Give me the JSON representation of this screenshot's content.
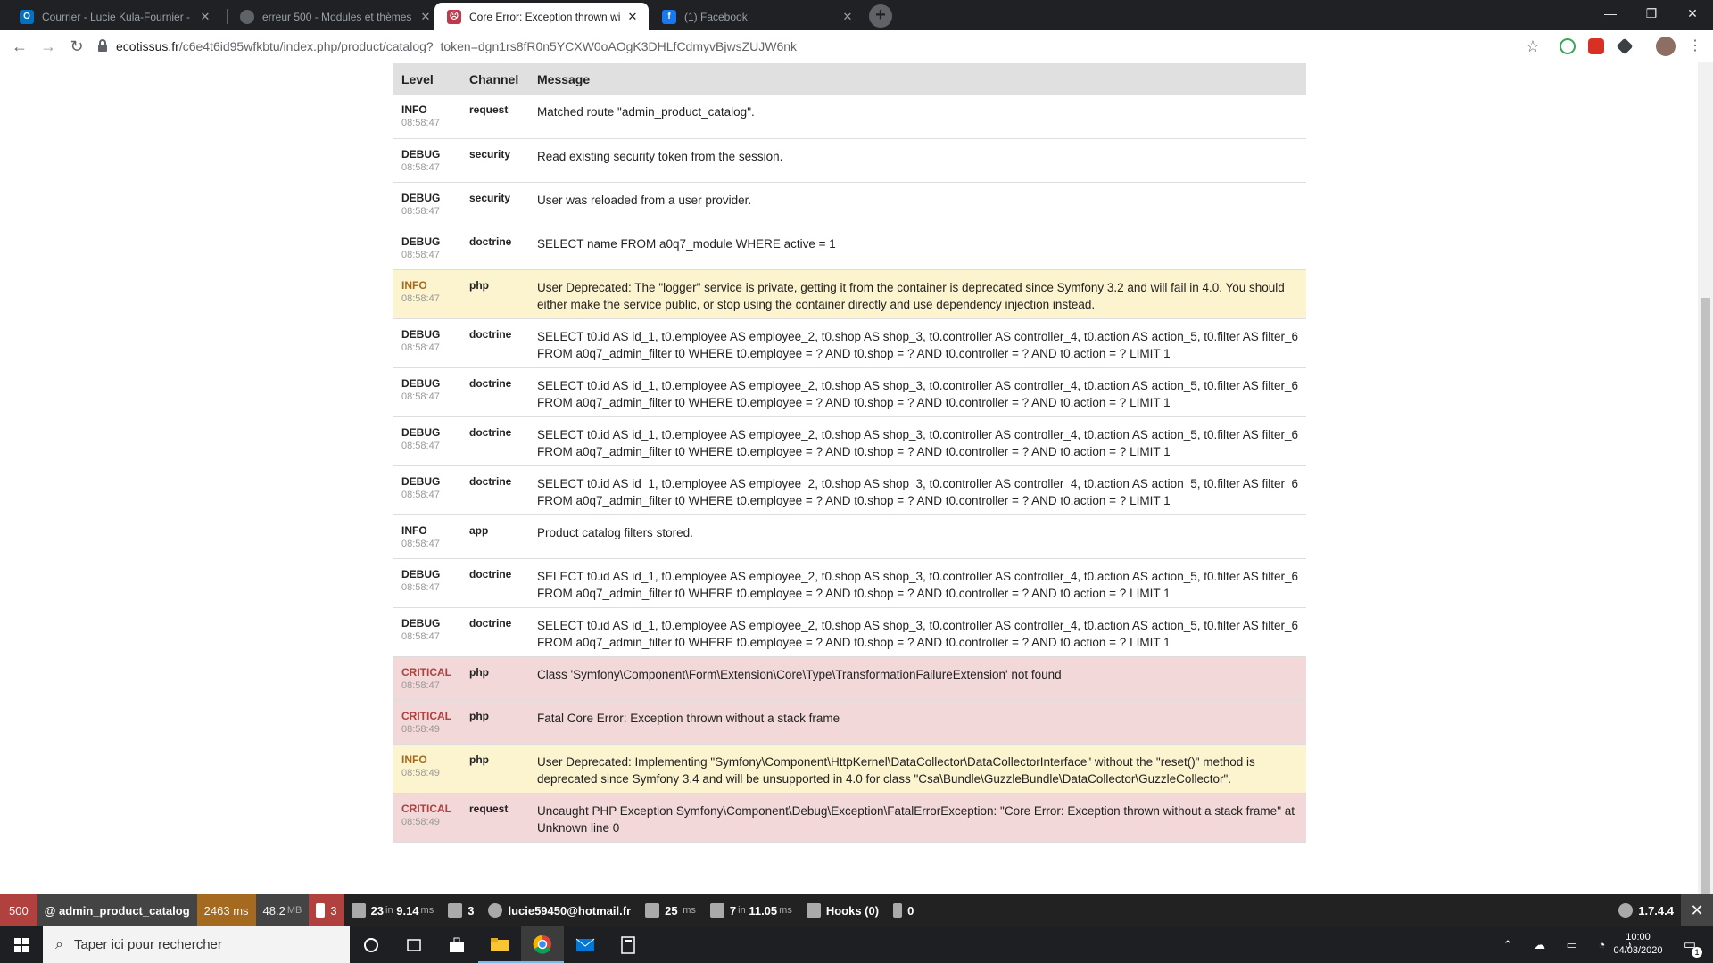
{
  "browser": {
    "tabs": [
      {
        "title": "Courrier - Lucie Kula-Fournier - O",
        "icon": "outlook-icon",
        "color": "#0072c6",
        "glyph": "O",
        "active": false
      },
      {
        "title": "erreur 500 - Modules et thèmes",
        "icon": "forum-icon",
        "color": "#5f6368",
        "glyph": "",
        "active": false
      },
      {
        "title": "Core Error: Exception thrown wit",
        "icon": "symfony-error-icon",
        "color": "#c0394a",
        "glyph": "",
        "active": true
      },
      {
        "title": "(1) Facebook",
        "icon": "facebook-icon",
        "color": "#1877f2",
        "glyph": "f",
        "active": false
      }
    ],
    "url_host": "ecotissus.fr",
    "url_path": "/c6e4t6id95wfkbtu/index.php/product/catalog?_token=dgn1rs8fR0n5YCXW0oAOgK3DHLfCdmyvBjwsZUJW6nk"
  },
  "log": {
    "headers": {
      "level": "Level",
      "channel": "Channel",
      "message": "Message"
    },
    "rows": [
      {
        "level": "INFO",
        "time": "08:58:47",
        "channel": "request",
        "message": "Matched route \"admin_product_catalog\".",
        "kind": "normal"
      },
      {
        "level": "DEBUG",
        "time": "08:58:47",
        "channel": "security",
        "message": "Read existing security token from the session.",
        "kind": "normal"
      },
      {
        "level": "DEBUG",
        "time": "08:58:47",
        "channel": "security",
        "message": "User was reloaded from a user provider.",
        "kind": "normal"
      },
      {
        "level": "DEBUG",
        "time": "08:58:47",
        "channel": "doctrine",
        "message": "SELECT name FROM a0q7_module WHERE active = 1",
        "kind": "normal"
      },
      {
        "level": "INFO",
        "time": "08:58:47",
        "channel": "php",
        "message": "User Deprecated: The \"logger\" service is private, getting it from the container is deprecated since Symfony 3.2 and will fail in 4.0. You should either make the service public, or stop using the container directly and use dependency injection instead.",
        "kind": "warn"
      },
      {
        "level": "DEBUG",
        "time": "08:58:47",
        "channel": "doctrine",
        "message": "SELECT t0.id AS id_1, t0.employee AS employee_2, t0.shop AS shop_3, t0.controller AS controller_4, t0.action AS action_5, t0.filter AS filter_6 FROM a0q7_admin_filter t0 WHERE t0.employee = ? AND t0.shop = ? AND t0.controller = ? AND t0.action = ? LIMIT 1",
        "kind": "normal"
      },
      {
        "level": "DEBUG",
        "time": "08:58:47",
        "channel": "doctrine",
        "message": "SELECT t0.id AS id_1, t0.employee AS employee_2, t0.shop AS shop_3, t0.controller AS controller_4, t0.action AS action_5, t0.filter AS filter_6 FROM a0q7_admin_filter t0 WHERE t0.employee = ? AND t0.shop = ? AND t0.controller = ? AND t0.action = ? LIMIT 1",
        "kind": "normal"
      },
      {
        "level": "DEBUG",
        "time": "08:58:47",
        "channel": "doctrine",
        "message": "SELECT t0.id AS id_1, t0.employee AS employee_2, t0.shop AS shop_3, t0.controller AS controller_4, t0.action AS action_5, t0.filter AS filter_6 FROM a0q7_admin_filter t0 WHERE t0.employee = ? AND t0.shop = ? AND t0.controller = ? AND t0.action = ? LIMIT 1",
        "kind": "normal"
      },
      {
        "level": "DEBUG",
        "time": "08:58:47",
        "channel": "doctrine",
        "message": "SELECT t0.id AS id_1, t0.employee AS employee_2, t0.shop AS shop_3, t0.controller AS controller_4, t0.action AS action_5, t0.filter AS filter_6 FROM a0q7_admin_filter t0 WHERE t0.employee = ? AND t0.shop = ? AND t0.controller = ? AND t0.action = ? LIMIT 1",
        "kind": "normal"
      },
      {
        "level": "INFO",
        "time": "08:58:47",
        "channel": "app",
        "message": "Product catalog filters stored.",
        "kind": "normal"
      },
      {
        "level": "DEBUG",
        "time": "08:58:47",
        "channel": "doctrine",
        "message": "SELECT t0.id AS id_1, t0.employee AS employee_2, t0.shop AS shop_3, t0.controller AS controller_4, t0.action AS action_5, t0.filter AS filter_6 FROM a0q7_admin_filter t0 WHERE t0.employee = ? AND t0.shop = ? AND t0.controller = ? AND t0.action = ? LIMIT 1",
        "kind": "normal"
      },
      {
        "level": "DEBUG",
        "time": "08:58:47",
        "channel": "doctrine",
        "message": "SELECT t0.id AS id_1, t0.employee AS employee_2, t0.shop AS shop_3, t0.controller AS controller_4, t0.action AS action_5, t0.filter AS filter_6 FROM a0q7_admin_filter t0 WHERE t0.employee = ? AND t0.shop = ? AND t0.controller = ? AND t0.action = ? LIMIT 1",
        "kind": "normal"
      },
      {
        "level": "CRITICAL",
        "time": "08:58:47",
        "channel": "php",
        "message": "Class 'Symfony\\Component\\Form\\Extension\\Core\\Type\\TransformationFailureExtension' not found",
        "kind": "err"
      },
      {
        "level": "CRITICAL",
        "time": "08:58:49",
        "channel": "php",
        "message": "Fatal Core Error: Exception thrown without a stack frame",
        "kind": "err"
      },
      {
        "level": "INFO",
        "time": "08:58:49",
        "channel": "php",
        "message": "User Deprecated: Implementing \"Symfony\\Component\\HttpKernel\\DataCollector\\DataCollectorInterface\" without the \"reset()\" method is deprecated since Symfony 3.4 and will be unsupported in 4.0 for class \"Csa\\Bundle\\GuzzleBundle\\DataCollector\\GuzzleCollector\".",
        "kind": "warn"
      },
      {
        "level": "CRITICAL",
        "time": "08:58:49",
        "channel": "request",
        "message": "Uncaught PHP Exception Symfony\\Component\\Debug\\Exception\\FatalErrorException: \"Core Error: Exception thrown without a stack frame\" at Unknown line 0",
        "kind": "err"
      }
    ]
  },
  "profiler": {
    "status_code": "500",
    "route": "@ admin_product_catalog",
    "time_value": "2463",
    "time_unit": "ms",
    "memory_value": "48.2",
    "memory_unit": "MB",
    "errors": "3",
    "forms_value": "23",
    "forms_in": "in",
    "forms_time": "9.14",
    "forms_unit": "ms",
    "translations": "3",
    "user": "lucie59450@hotmail.fr",
    "render_value": "25",
    "render_unit": "ms",
    "db_value": "7",
    "db_in": "in",
    "db_time": "11.05",
    "db_unit": "ms",
    "hooks": "Hooks (0)",
    "modules": "0",
    "version": "1.7.4.4",
    "colors": {
      "status_500": "#b0413e",
      "time_warn": "#a46a1f",
      "errors": "#b0413e"
    }
  },
  "taskbar": {
    "search_placeholder": "Taper ici pour rechercher",
    "clock_time": "10:00",
    "clock_date": "04/03/2020",
    "notifications": "1"
  }
}
